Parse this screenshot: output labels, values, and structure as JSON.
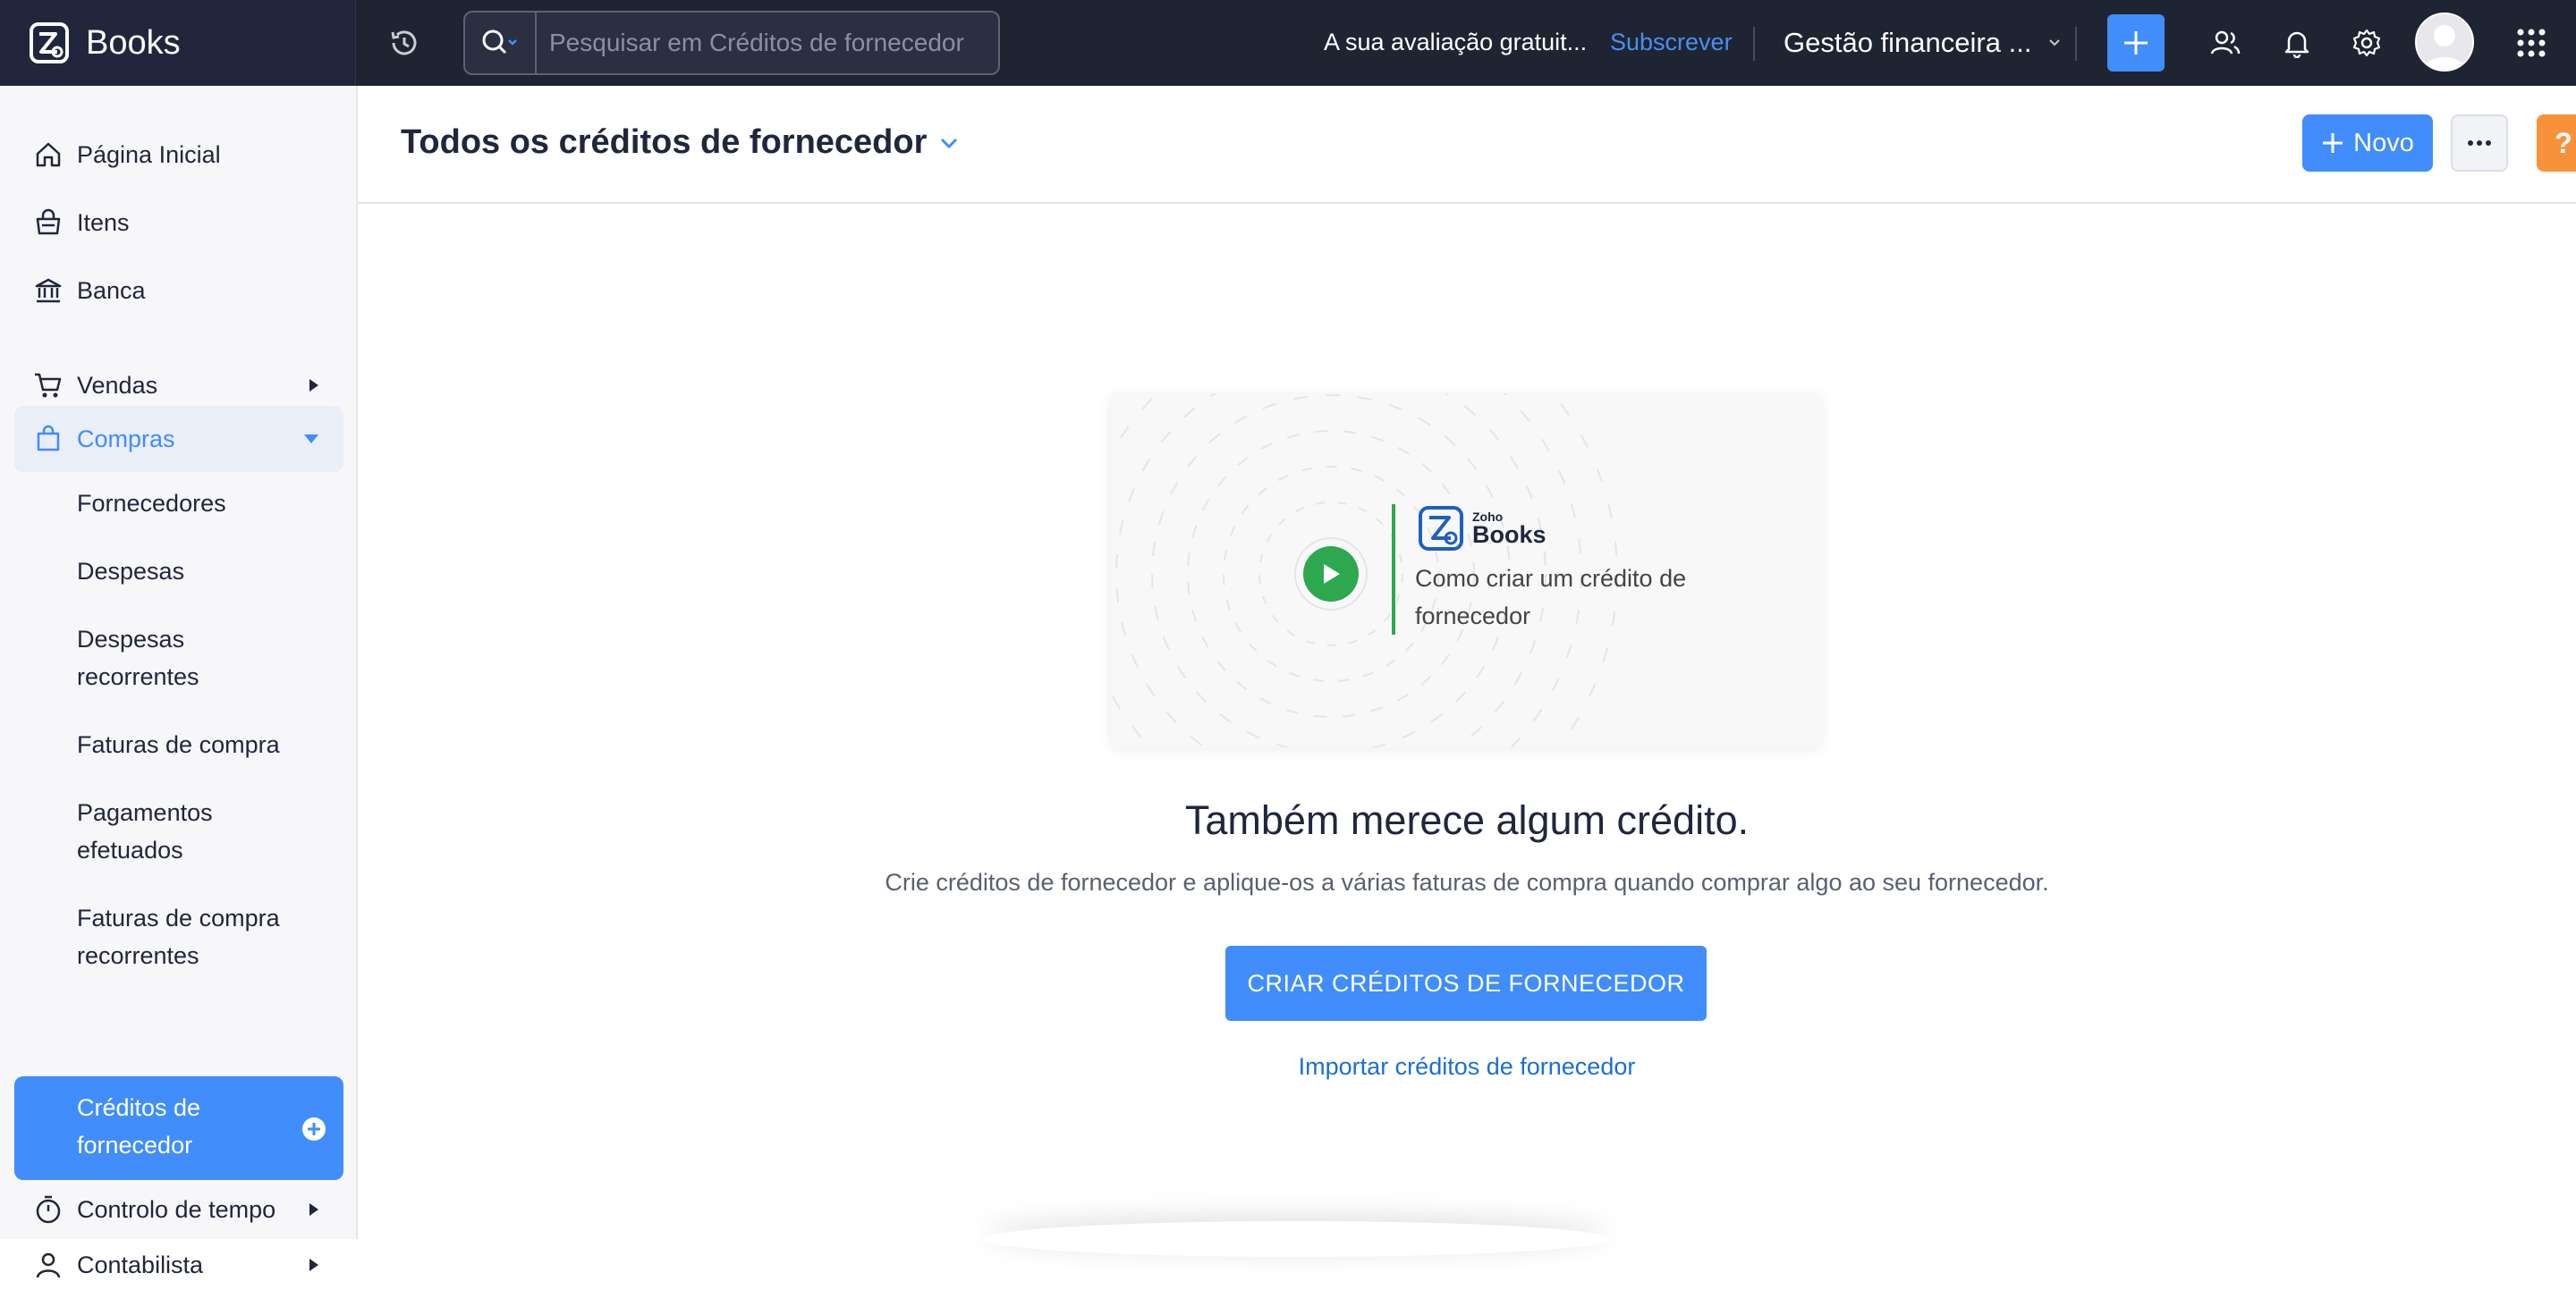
{
  "app": {
    "name": "Books"
  },
  "topbar": {
    "search_placeholder": "Pesquisar em Créditos de fornecedor",
    "trial_text": "A sua avaliação gratuit...",
    "subscribe_label": "Subscrever",
    "org_name": "Gestão financeira ..."
  },
  "sidebar": {
    "items": [
      {
        "label": "Página Inicial",
        "icon": "home-icon"
      },
      {
        "label": "Itens",
        "icon": "basket-icon"
      },
      {
        "label": "Banca",
        "icon": "bank-icon"
      },
      {
        "label": "Vendas",
        "icon": "cart-icon"
      },
      {
        "label": "Compras",
        "icon": "bag-icon"
      },
      {
        "label": "Controlo de tempo",
        "icon": "stopwatch-icon"
      },
      {
        "label": "Contabilista",
        "icon": "person-icon"
      }
    ],
    "purchases_sub": [
      {
        "label": "Fornecedores"
      },
      {
        "label": "Despesas"
      },
      {
        "label": "Despesas recorrentes"
      },
      {
        "label": "Faturas de compra"
      },
      {
        "label": "Pagamentos efetuados"
      },
      {
        "label": "Faturas de compra recorrentes"
      },
      {
        "label": "Créditos de fornecedor"
      }
    ]
  },
  "header": {
    "title": "Todos os créditos de fornecedor",
    "new_label": "Novo",
    "help_label": "?"
  },
  "video": {
    "logo_small": "Zoho",
    "logo_big": "Books",
    "caption": "Como criar um crédito de fornecedor"
  },
  "empty_state": {
    "headline": "Também merece algum crédito.",
    "description": "Crie créditos de fornecedor e aplique-os a várias faturas de compra quando comprar algo ao seu fornecedor.",
    "cta_label": "CRIAR CRÉDITOS DE FORNECEDOR",
    "import_label": "Importar créditos de fornecedor"
  },
  "colors": {
    "accent": "#408dfb",
    "topbar": "#1f2433",
    "play": "#2ea84f",
    "help": "#f7923a"
  }
}
